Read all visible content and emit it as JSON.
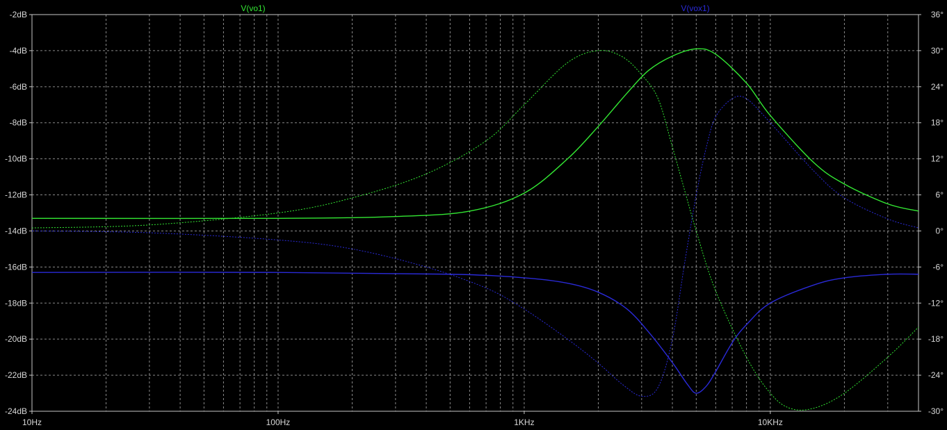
{
  "chart_data": {
    "type": "line",
    "xscale": "log",
    "xlim": [
      10,
      40000
    ],
    "left_ylim": [
      -24,
      -2
    ],
    "right_ylim": [
      -30,
      36
    ],
    "x_ticks": [
      {
        "value": 10,
        "label": "10Hz"
      },
      {
        "value": 100,
        "label": "100Hz"
      },
      {
        "value": 1000,
        "label": "1KHz"
      },
      {
        "value": 10000,
        "label": "10KHz"
      }
    ],
    "left_ticks": [
      "-2dB",
      "-4dB",
      "-6dB",
      "-8dB",
      "-10dB",
      "-12dB",
      "-14dB",
      "-16dB",
      "-18dB",
      "-20dB",
      "-22dB",
      "-24dB"
    ],
    "right_ticks": [
      "36°",
      "30°",
      "24°",
      "18°",
      "12°",
      "6°",
      "0°",
      "-6°",
      "-12°",
      "-18°",
      "-24°",
      "-30°"
    ],
    "grid": true,
    "colors": {
      "background": "#000000",
      "grid": "#8a8a8a",
      "axis": "#c8c8c8",
      "vo1": "#33e833",
      "vox1": "#2a2ad8"
    },
    "series": [
      {
        "name": "V(vo1)",
        "kind": "magnitude",
        "color": "#33e833",
        "axis": "left",
        "x": [
          10,
          100,
          300,
          600,
          1000,
          1500,
          2000,
          2600,
          3200,
          4000,
          5000,
          6000,
          8000,
          10000,
          15000,
          20000,
          30000,
          40000
        ],
        "y": [
          -13.3,
          -13.3,
          -13.2,
          -12.9,
          -11.9,
          -10.0,
          -8.2,
          -6.4,
          -5.1,
          -4.3,
          -3.9,
          -4.2,
          -5.8,
          -7.6,
          -10.2,
          -11.4,
          -12.5,
          -12.9
        ]
      },
      {
        "name": "V(vo1)",
        "kind": "phase",
        "color": "#33e833",
        "axis": "right",
        "x": [
          10,
          30,
          100,
          200,
          400,
          700,
          1000,
          1500,
          2000,
          2500,
          3000,
          3500,
          4000,
          5000,
          6000,
          8000,
          10000,
          12000,
          15000,
          20000,
          30000,
          40000
        ],
        "y": [
          0.5,
          1.0,
          3.0,
          5.5,
          9.5,
          15,
          21,
          28,
          30,
          29,
          26,
          22,
          14,
          0,
          -10,
          -21,
          -27,
          -29.5,
          -29.5,
          -27,
          -21,
          -16
        ]
      },
      {
        "name": "V(vox1)",
        "kind": "magnitude",
        "color": "#2a2ad8",
        "axis": "left",
        "x": [
          10,
          100,
          500,
          1000,
          1500,
          2000,
          2600,
          3200,
          4000,
          4600,
          5000,
          5500,
          6000,
          7000,
          8000,
          10000,
          15000,
          20000,
          30000,
          40000
        ],
        "y": [
          -16.3,
          -16.3,
          -16.4,
          -16.6,
          -16.9,
          -17.4,
          -18.3,
          -19.6,
          -21.3,
          -22.5,
          -23.0,
          -22.6,
          -21.8,
          -20.2,
          -19.2,
          -18.0,
          -17.0,
          -16.6,
          -16.4,
          -16.4
        ]
      },
      {
        "name": "V(vox1)",
        "kind": "phase",
        "color": "#2a2ad8",
        "axis": "right",
        "x": [
          10,
          30,
          100,
          200,
          400,
          700,
          1000,
          1500,
          2000,
          2500,
          3000,
          3500,
          4000,
          4500,
          5000,
          5500,
          6000,
          7000,
          8000,
          10000,
          15000,
          20000,
          30000,
          40000
        ],
        "y": [
          0,
          -0.3,
          -1.5,
          -3,
          -6,
          -9.5,
          -13,
          -18,
          -22,
          -25.5,
          -27.5,
          -26,
          -18,
          -5,
          6,
          14,
          19,
          22,
          22,
          18,
          10,
          5.5,
          2,
          0.5
        ]
      }
    ]
  }
}
